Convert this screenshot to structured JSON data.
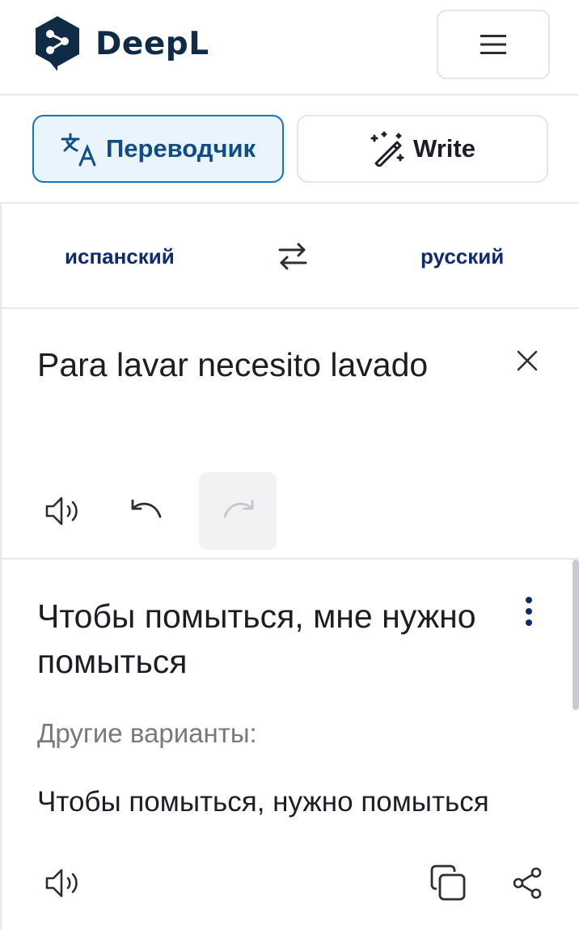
{
  "header": {
    "brand": "DeepL",
    "icons": {
      "logo": "deepl-logo-icon",
      "menu": "hamburger-menu-icon"
    }
  },
  "tabs": [
    {
      "label": "Переводчик",
      "icon": "translate-icon",
      "active": true
    },
    {
      "label": "Write",
      "icon": "magic-pen-icon",
      "active": false
    }
  ],
  "languages": {
    "source": "испанский",
    "target": "русский",
    "swap_icon": "swap-arrows-icon"
  },
  "source": {
    "text": "Para lavar necesito lavado",
    "icons": {
      "clear": "close-icon",
      "listen": "speaker-icon",
      "undo": "undo-icon",
      "redo": "redo-icon"
    },
    "redo_disabled": true
  },
  "target": {
    "text": "Чтобы помыться, мне нужно помыться",
    "alternatives_label": "Другие варианты:",
    "alternatives": [
      "Чтобы помыться, нужно помыться"
    ],
    "icons": {
      "more": "more-vertical-icon",
      "listen": "speaker-icon",
      "copy": "copy-icon",
      "share": "share-icon"
    }
  },
  "colors": {
    "accent": "#0f75bc",
    "brand_dark": "#0f2b46",
    "active_tab_bg": "#eaf4fc",
    "language_text": "#0f2b6e"
  }
}
